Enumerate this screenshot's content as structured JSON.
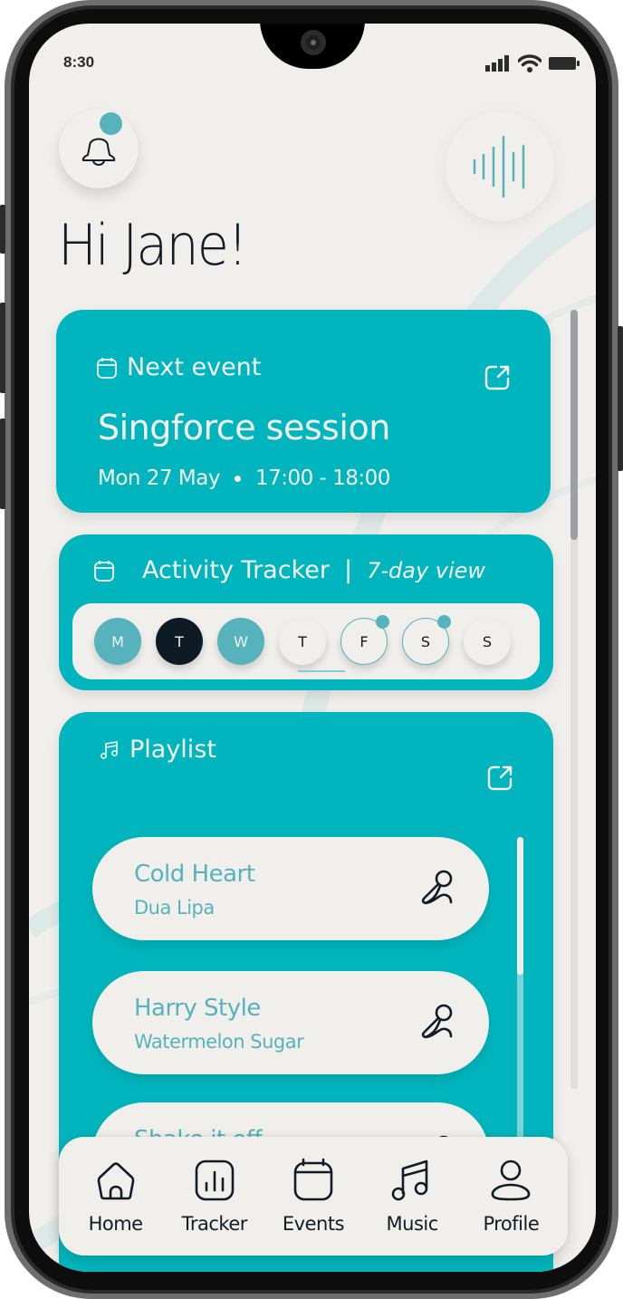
{
  "status_bar": {
    "time": "8:30",
    "icons": [
      "signal-icon",
      "wifi-icon",
      "battery-icon"
    ]
  },
  "header": {
    "notification_icon": "bell-icon",
    "notification_badge": true,
    "voice_icon": "sound-wave-icon",
    "greeting": "Hi Jane!"
  },
  "next_event": {
    "title": "Next event",
    "icon": "calendar-icon",
    "open_icon": "external-link-icon",
    "name": "Singforce session",
    "date": "Mon 27 May",
    "time": "17:00 - 18:00"
  },
  "activity_tracker": {
    "title": "Activity Tracker",
    "separator": "|",
    "subtitle": "7-day view",
    "icon": "calendar-icon",
    "days": [
      {
        "label": "M",
        "state": "done",
        "dot": false
      },
      {
        "label": "T",
        "state": "current",
        "dot": false
      },
      {
        "label": "W",
        "state": "done",
        "dot": false
      },
      {
        "label": "T",
        "state": "today",
        "dot": false
      },
      {
        "label": "F",
        "state": "planned",
        "dot": true
      },
      {
        "label": "S",
        "state": "planned",
        "dot": true
      },
      {
        "label": "S",
        "state": "empty",
        "dot": false
      }
    ]
  },
  "playlist": {
    "title": "Playlist",
    "icon": "music-note-icon",
    "open_icon": "external-link-icon",
    "songs": [
      {
        "title": "Cold Heart",
        "artist": "Dua Lipa",
        "action_icon": "microphone-icon"
      },
      {
        "title": "Harry Style",
        "artist": "Watermelon Sugar",
        "action_icon": "microphone-icon"
      },
      {
        "title": "Shake it off",
        "artist": "",
        "action_icon": "microphone-icon"
      }
    ]
  },
  "bottom_nav": {
    "items": [
      {
        "label": "Home",
        "icon": "home-icon"
      },
      {
        "label": "Tracker",
        "icon": "chart-icon"
      },
      {
        "label": "Events",
        "icon": "calendar-icon"
      },
      {
        "label": "Music",
        "icon": "music-icon"
      },
      {
        "label": "Profile",
        "icon": "user-icon"
      }
    ]
  },
  "colors": {
    "accent": "#00b5bd",
    "accent_soft": "#56b3bb",
    "background": "#f0efeb",
    "text_dark": "#121c24"
  }
}
